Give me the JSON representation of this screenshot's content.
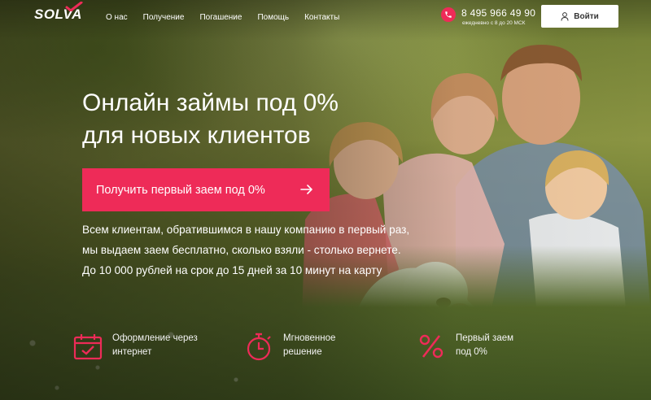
{
  "header": {
    "logo": "SOLVA",
    "nav": [
      {
        "label": "О нас"
      },
      {
        "label": "Получение"
      },
      {
        "label": "Погашение"
      },
      {
        "label": "Помощь"
      },
      {
        "label": "Контакты"
      }
    ],
    "phone": "8 495 966 49 90",
    "phone_hours": "ежедневно с 8 до 20 МСК",
    "login_label": "Войти"
  },
  "hero": {
    "title_line1": "Онлайн займы под 0%",
    "title_line2": "для новых клиентов",
    "cta_label": "Получить первый заем под 0%",
    "desc_line1": "Всем клиентам, обратившимся в нашу компанию в первый раз,",
    "desc_line2": "мы выдаем заем бесплатно, сколько взяли - столько вернете.",
    "desc_line3": "До 10 000 рублей на срок до 15 дней за 10 минут на карту"
  },
  "features": [
    {
      "icon": "calendar-check-icon",
      "line1": "Оформление через",
      "line2": "интернет"
    },
    {
      "icon": "stopwatch-icon",
      "line1": "Мгновенное",
      "line2": "решение"
    },
    {
      "icon": "percent-icon",
      "line1": "Первый заем",
      "line2": "под 0%"
    }
  ],
  "colors": {
    "accent": "#ee2b58",
    "text": "#ffffff",
    "login_bg": "#ffffff"
  }
}
